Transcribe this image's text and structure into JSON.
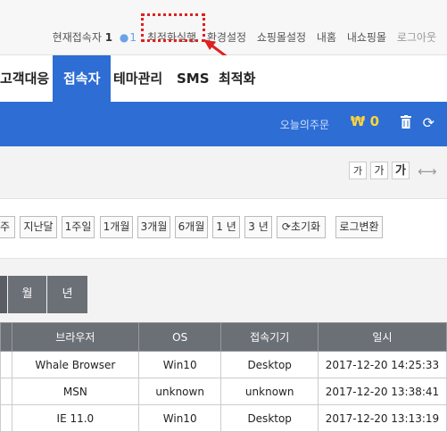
{
  "header": {
    "visitors_label": "현재접속자",
    "visitors_count": "1",
    "visitors_icon_count": "1",
    "links": [
      "최적화실행",
      "환경설정",
      "쇼핑몰설정",
      "내홈",
      "내쇼핑몰",
      "로그아웃"
    ]
  },
  "nav": {
    "items": [
      "고객대응",
      "접속자",
      "테마관리",
      "SMS",
      "최적화"
    ],
    "active": "접속자"
  },
  "order_bar": {
    "label": "오늘의주문",
    "currency": "₩",
    "amount": "0"
  },
  "font_size_buttons": [
    "가",
    "가",
    "가"
  ],
  "filter": {
    "buttons": [
      "주",
      "지난달",
      "1주일",
      "1개월",
      "3개월",
      "6개월",
      "1 년",
      "3 년",
      "초기화",
      "로그변환"
    ]
  },
  "period_tabs": [
    "월",
    "년"
  ],
  "table": {
    "columns": [
      "",
      "브라우저",
      "OS",
      "접속기기",
      "일시"
    ],
    "rows": [
      [
        "",
        "Whale Browser",
        "Win10",
        "Desktop",
        "2017-12-20 14:25:33"
      ],
      [
        "",
        "MSN",
        "unknown",
        "unknown",
        "2017-12-20 13:38:41"
      ],
      [
        "",
        "IE 11.0",
        "Win10",
        "Desktop",
        "2017-12-20 13:13:19"
      ]
    ]
  },
  "colors": {
    "primary_blue": "#2d6dd4",
    "highlight_red": "#e0201f",
    "amount_yellow": "#ffd43b",
    "tab_gray": "#6b6f76"
  },
  "icons": [
    "person-icon",
    "trash-icon",
    "refresh-icon",
    "resize-arrows-icon",
    "red-arrow-icon"
  ]
}
